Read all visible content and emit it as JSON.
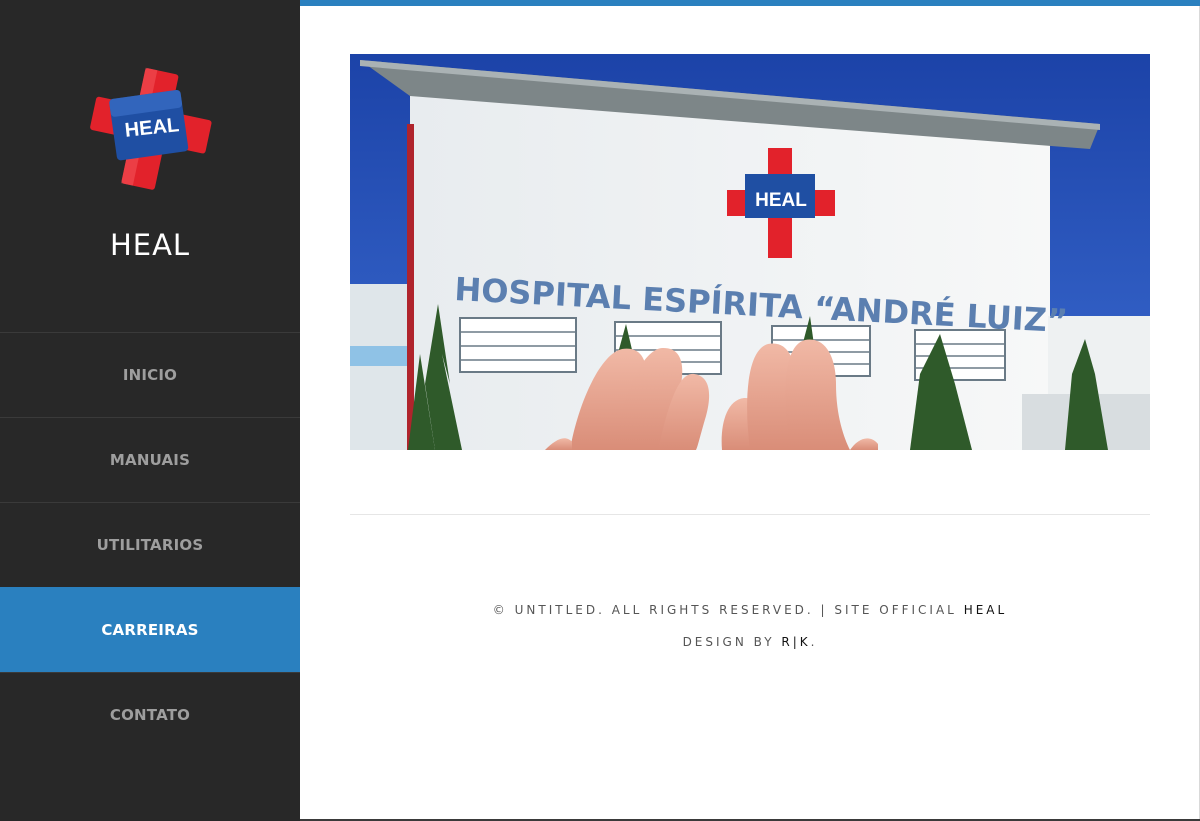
{
  "site": {
    "title": "HEAL",
    "logo_text": "HEAL"
  },
  "nav": {
    "items": [
      {
        "label": "INICIO",
        "active": false
      },
      {
        "label": "MANUAIS",
        "active": false
      },
      {
        "label": "UTILITARIOS",
        "active": false
      },
      {
        "label": "CARREIRAS",
        "active": true
      },
      {
        "label": "CONTATO",
        "active": false
      }
    ]
  },
  "hero": {
    "sign_text": "HOSPITAL ESPÍRITA “ANDRÉ LUIZ”",
    "logo_text": "HEAL"
  },
  "footer": {
    "copyright": "© UNTITLED. ALL RIGHTS RESERVED. | SITE OFFICIAL ",
    "site_link": "HEAL",
    "design_prefix": "DESIGN BY ",
    "design_link": "R|K",
    "design_suffix": "."
  },
  "colors": {
    "accent": "#2a80bf",
    "sidebar_bg": "#282828",
    "nav_text": "#9e9e9e",
    "logo_red": "#e2222b",
    "logo_blue": "#1f4fa3"
  }
}
